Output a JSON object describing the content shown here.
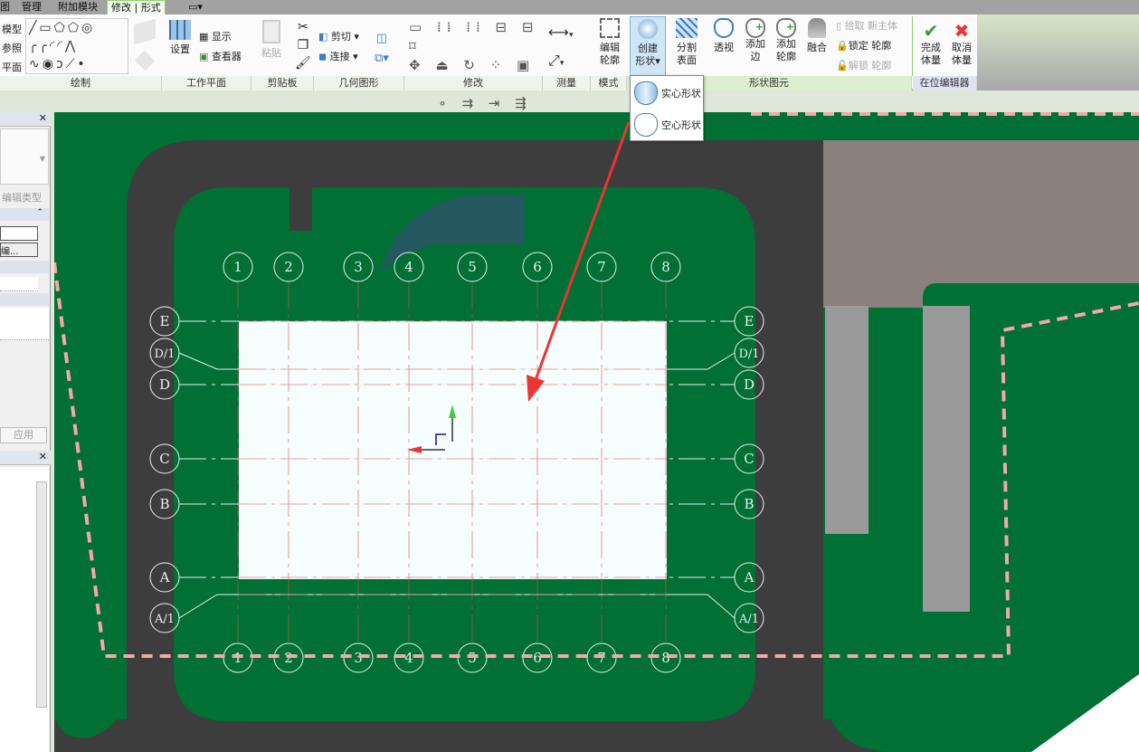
{
  "tabs": [
    {
      "label": "图"
    },
    {
      "label": "管理"
    },
    {
      "label": "附加模块"
    },
    {
      "label": "修改 | 形式",
      "active": true
    }
  ],
  "ribbon": {
    "draw": {
      "label": "绘制",
      "items": [
        "模型",
        "参照",
        "平面"
      ]
    },
    "workplane": {
      "label": "工作平面",
      "set": "设置",
      "show": "显示",
      "viewer": "查看器"
    },
    "clipboard": {
      "label": "剪贴板",
      "paste": "粘贴"
    },
    "geometry": {
      "label": "几何图形",
      "cut": "剪切",
      "join": "连接"
    },
    "modify": {
      "label": "修改"
    },
    "measure": {
      "label": "测量"
    },
    "mode": {
      "label": "模式",
      "edit_profile": [
        "编辑",
        "轮廓"
      ]
    },
    "create_form": [
      "创建",
      "形状"
    ],
    "divide_surface": [
      "分割",
      "表面"
    ],
    "form_element": {
      "label": "形状图元",
      "xray": "透视",
      "add_edge": [
        "添加",
        "边"
      ],
      "add_profile": [
        "添加",
        "轮廓"
      ],
      "dissolve": "融合",
      "pick_new_host": "拾取 新主体",
      "lock_profile": "锁定 轮廓",
      "unlock_profile": "解锁 轮廓"
    },
    "inplace_editor": {
      "label": "在位编辑器",
      "finish": [
        "完成",
        "体量"
      ],
      "cancel": [
        "取消",
        "体量"
      ]
    }
  },
  "dropdown": {
    "solid_form": "实心形状",
    "void_form": "空心形状"
  },
  "properties": {
    "edit_type": "编辑类型",
    "apply": "应用",
    "button_ellipsis": "编..."
  },
  "grid": {
    "columns": [
      "1",
      "2",
      "3",
      "4",
      "5",
      "6",
      "7",
      "8"
    ],
    "rows": [
      "E",
      "D/1",
      "D",
      "C",
      "B",
      "A",
      "A/1"
    ]
  },
  "colors": {
    "accent_green": "#8fd16e",
    "site_green": "#007034",
    "road": "#3d3d3d",
    "boundary": "#f4a8a8",
    "arrow": "#ee3333"
  }
}
